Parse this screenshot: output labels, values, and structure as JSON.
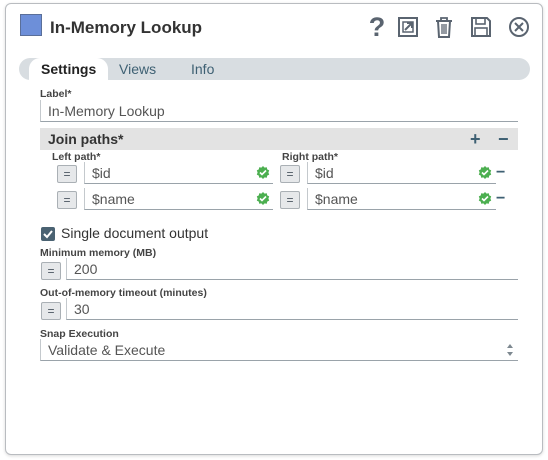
{
  "header": {
    "title": "In-Memory Lookup",
    "help_glyph": "?",
    "icons": [
      "export-icon",
      "delete-icon",
      "save-icon",
      "close-icon"
    ]
  },
  "tabs": [
    {
      "label": "Settings",
      "active": true
    },
    {
      "label": "Views",
      "active": false
    },
    {
      "label": "Info",
      "active": false
    }
  ],
  "form": {
    "label_field": {
      "label": "Label*",
      "value": "In-Memory Lookup"
    },
    "join_paths": {
      "title": "Join paths*",
      "add": "+",
      "remove": "−",
      "left_header": "Left path*",
      "right_header": "Right path*",
      "rows": [
        {
          "left": "$id",
          "right": "$id"
        },
        {
          "left": "$name",
          "right": "$name"
        }
      ]
    },
    "single_doc": {
      "label": "Single document output",
      "checked": true
    },
    "min_memory": {
      "label": "Minimum memory (MB)",
      "value": "200"
    },
    "oom_timeout": {
      "label": "Out-of-memory timeout (minutes)",
      "value": "30"
    },
    "snap_execution": {
      "label": "Snap Execution",
      "value": "Validate & Execute"
    }
  },
  "colors": {
    "accent": "#3e6073",
    "check_green": "#4caf50",
    "snap_icon": "#6d8fd9"
  }
}
